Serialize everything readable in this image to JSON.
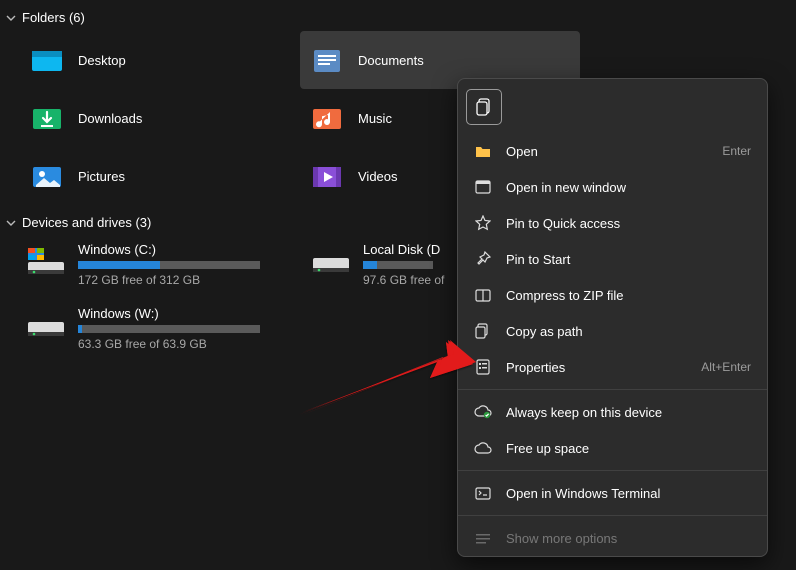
{
  "sections": {
    "folders": {
      "title": "Folders (6)"
    },
    "drives": {
      "title": "Devices and drives (3)"
    }
  },
  "folders": [
    {
      "name": "Desktop"
    },
    {
      "name": "Documents"
    },
    {
      "name": "Downloads"
    },
    {
      "name": "Music"
    },
    {
      "name": "Pictures"
    },
    {
      "name": "Videos"
    }
  ],
  "drives": [
    {
      "name": "Windows (C:)",
      "free": "172 GB free of 312 GB",
      "fill_pct": 45
    },
    {
      "name": "Local Disk (D",
      "free": "97.6 GB free of",
      "fill_pct": 20
    },
    {
      "name": "Windows (W:)",
      "free": "63.3 GB free of 63.9 GB",
      "fill_pct": 2
    }
  ],
  "context_menu": {
    "open": "Open",
    "open_accel": "Enter",
    "open_new_window": "Open in new window",
    "pin_quick": "Pin to Quick access",
    "pin_start": "Pin to Start",
    "compress": "Compress to ZIP file",
    "copy_path": "Copy as path",
    "properties": "Properties",
    "properties_accel": "Alt+Enter",
    "always_keep": "Always keep on this device",
    "free_up": "Free up space",
    "open_terminal": "Open in Windows Terminal",
    "show_more": "Show more options"
  }
}
